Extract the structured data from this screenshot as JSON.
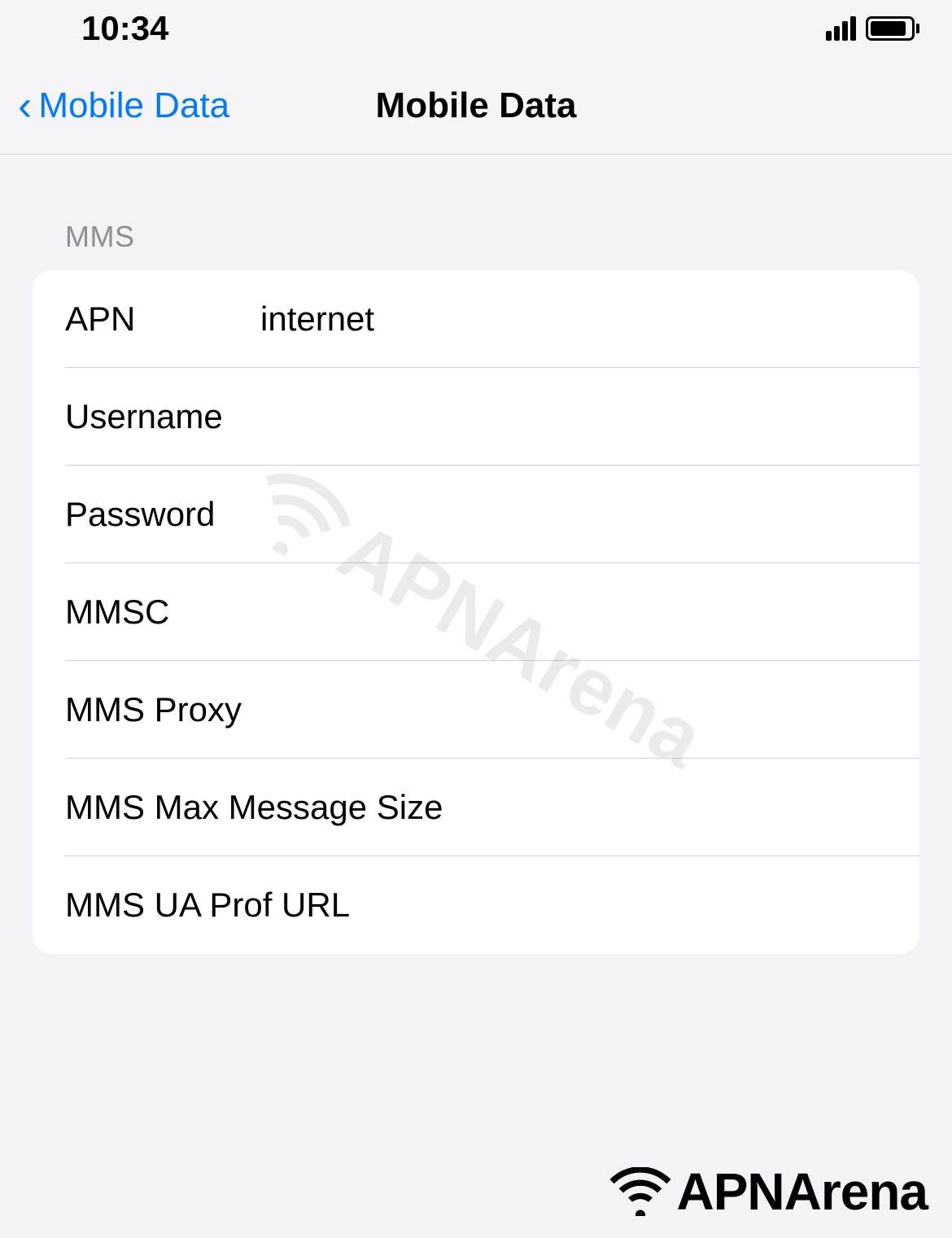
{
  "statusBar": {
    "time": "10:34"
  },
  "nav": {
    "backLabel": "Mobile Data",
    "title": "Mobile Data"
  },
  "section": {
    "header": "MMS",
    "rows": [
      {
        "label": "APN",
        "value": "internet"
      },
      {
        "label": "Username",
        "value": ""
      },
      {
        "label": "Password",
        "value": ""
      },
      {
        "label": "MMSC",
        "value": ""
      },
      {
        "label": "MMS Proxy",
        "value": ""
      },
      {
        "label": "MMS Max Message Size",
        "value": ""
      },
      {
        "label": "MMS UA Prof URL",
        "value": ""
      }
    ]
  },
  "watermark": {
    "text": "APNArena"
  },
  "footer": {
    "brand": "APNArena"
  }
}
